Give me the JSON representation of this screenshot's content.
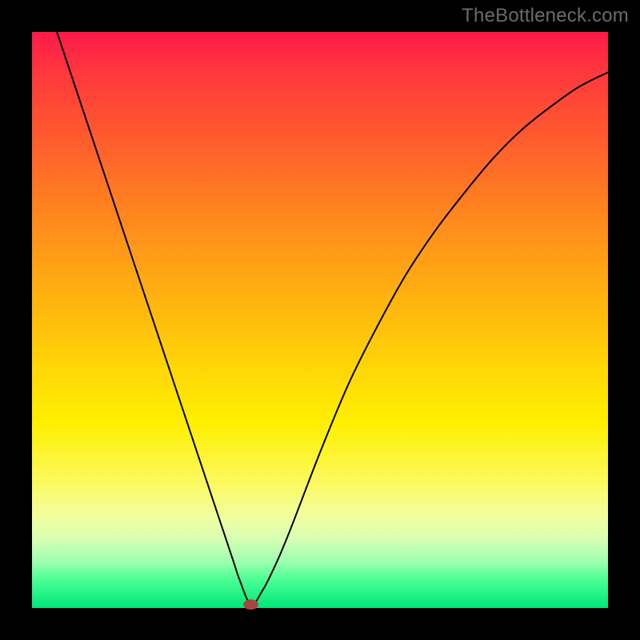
{
  "watermark": "TheBottleneck.com",
  "chart_data": {
    "type": "line",
    "title": "",
    "xlabel": "",
    "ylabel": "",
    "xlim": [
      0,
      100
    ],
    "ylim": [
      0,
      100
    ],
    "grid": false,
    "legend": false,
    "series": [
      {
        "name": "curve",
        "x": [
          0,
          5,
          10,
          15,
          20,
          25,
          30,
          33,
          35,
          36,
          38,
          40,
          42.5,
          45,
          50,
          55,
          60,
          65,
          70,
          75,
          80,
          85,
          90,
          95,
          100
        ],
        "y": [
          113,
          98,
          83,
          68,
          53,
          38,
          23,
          14,
          8,
          5,
          0.6,
          3,
          8,
          14,
          27,
          39,
          49,
          58,
          65.5,
          72,
          78,
          83,
          87,
          90.5,
          93
        ]
      }
    ],
    "marker": {
      "x": 38,
      "y": 0.6,
      "rx": 1.3,
      "ry": 0.9,
      "color": "#a94442"
    },
    "gradient_stops": [
      {
        "pct": 0,
        "color": "#ff1a4b"
      },
      {
        "pct": 8,
        "color": "#ff3b3b"
      },
      {
        "pct": 18,
        "color": "#ff5a2f"
      },
      {
        "pct": 28,
        "color": "#ff7a22"
      },
      {
        "pct": 38,
        "color": "#ff9a18"
      },
      {
        "pct": 48,
        "color": "#ffb80e"
      },
      {
        "pct": 58,
        "color": "#ffd507"
      },
      {
        "pct": 68,
        "color": "#fff000"
      },
      {
        "pct": 78,
        "color": "#fdf95c"
      },
      {
        "pct": 84,
        "color": "#f2ff9e"
      },
      {
        "pct": 88,
        "color": "#d8ffb3"
      },
      {
        "pct": 92,
        "color": "#9dffb0"
      },
      {
        "pct": 95,
        "color": "#4cff94"
      },
      {
        "pct": 100,
        "color": "#00e67a"
      }
    ]
  }
}
